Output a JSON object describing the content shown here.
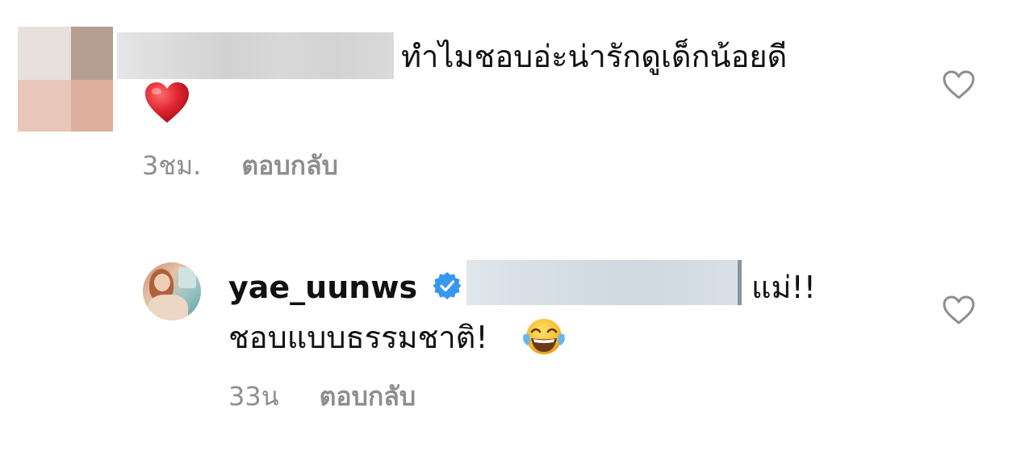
{
  "comments": [
    {
      "text": "ทำไมชอบอ่ะน่ารักดูเด็กน้อยดี",
      "emoji": "heart-emoji",
      "time": "3ชม.",
      "reply_label": "ตอบกลับ",
      "like_icon": "heart-outline-icon"
    },
    {
      "username": "yae_uunws",
      "verified": true,
      "text_line1": "แม่!!",
      "text_line2": "ชอบแบบธรรมชาติ!",
      "emoji": "face-with-tears-of-joy-emoji",
      "time": "33น",
      "reply_label": "ตอบกลับ",
      "like_icon": "heart-outline-icon"
    }
  ],
  "colors": {
    "meta_text": "#8e8e8e",
    "verified_blue": "#3897f0",
    "heart_red": "#e0242f"
  }
}
